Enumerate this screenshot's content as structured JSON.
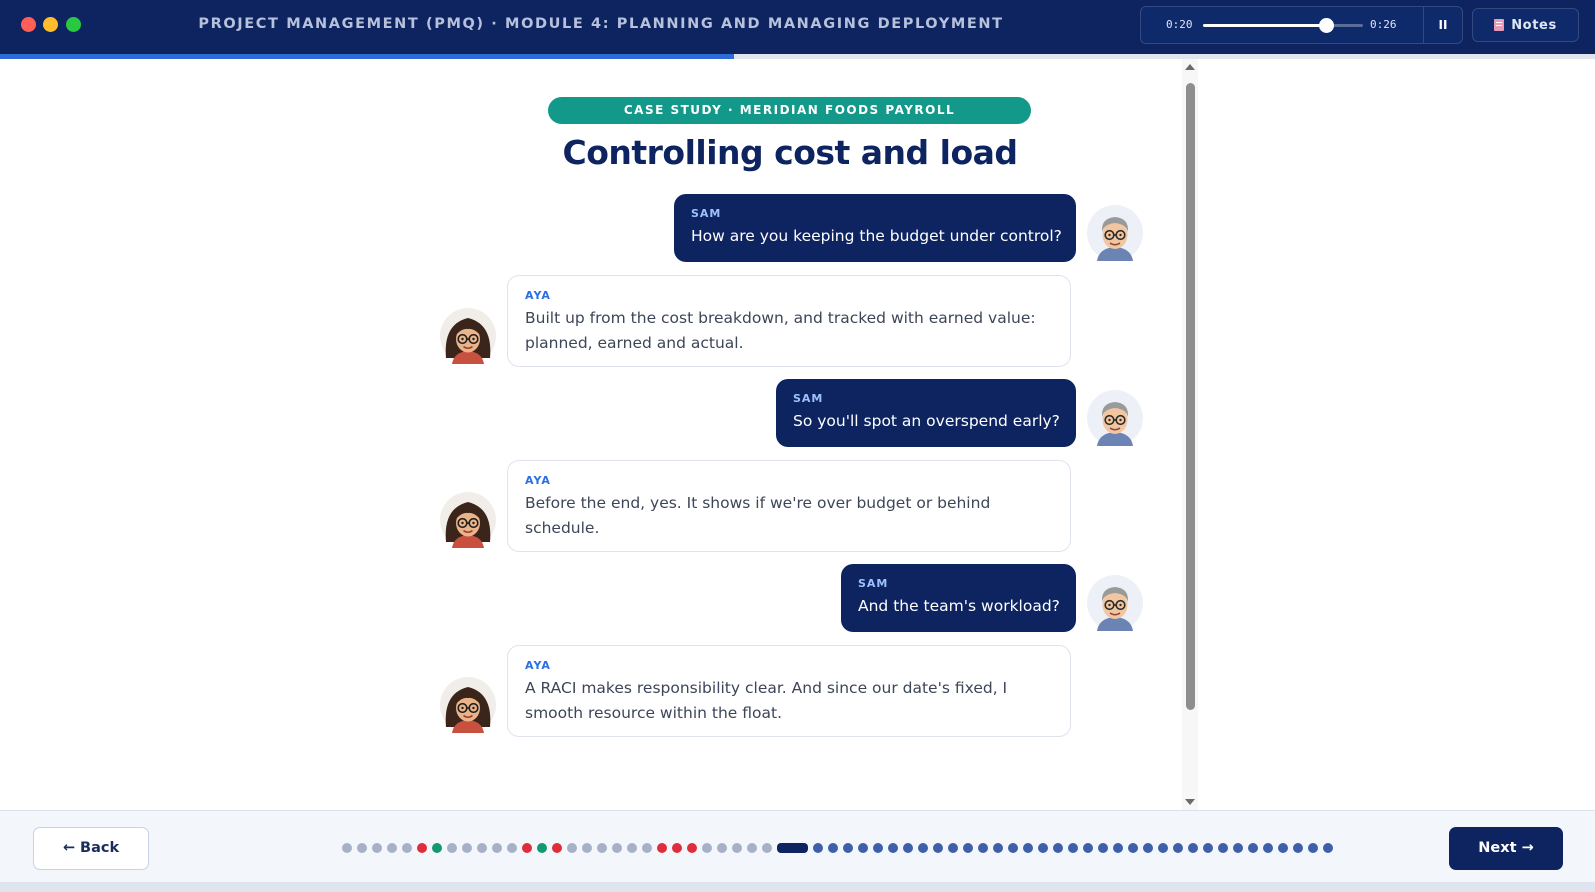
{
  "window": {
    "title": "PROJECT MANAGEMENT (PMQ) · MODULE 4: PLANNING AND MANAGING DEPLOYMENT"
  },
  "player": {
    "current_time": "0:20",
    "total_time": "0:26",
    "progress": 0.769,
    "pause_label": "II",
    "notes_label": "Notes"
  },
  "course_progress": 0.46,
  "slide": {
    "badge": "CASE STUDY · MERIDIAN FOODS PAYROLL",
    "title": "Controlling cost and load",
    "messages": [
      {
        "speaker": "SAM",
        "text": "How are you keeping the budget under control?"
      },
      {
        "speaker": "AYA",
        "text": "Built up from the cost breakdown, and tracked with earned value: planned, earned and actual."
      },
      {
        "speaker": "SAM",
        "text": "So you'll spot an overspend early?"
      },
      {
        "speaker": "AYA",
        "text": "Before the end, yes. It shows if we're over budget or behind schedule."
      },
      {
        "speaker": "SAM",
        "text": "And the team's workload?"
      },
      {
        "speaker": "AYA",
        "text": "A RACI makes responsibility clear. And since our date's fixed, I smooth resource within the float."
      }
    ]
  },
  "nav": {
    "back_label": "← Back",
    "next_label": "Next →",
    "slide_states": [
      "done",
      "done",
      "done",
      "done",
      "done",
      "wrong",
      "correct",
      "done",
      "done",
      "done",
      "done",
      "done",
      "wrong",
      "correct",
      "wrong",
      "done",
      "done",
      "done",
      "done",
      "done",
      "done",
      "wrong",
      "wrong",
      "wrong",
      "done",
      "done",
      "done",
      "done",
      "done",
      "current",
      "todo",
      "todo",
      "todo",
      "todo",
      "todo",
      "todo",
      "todo",
      "todo",
      "todo",
      "todo",
      "todo",
      "todo",
      "todo",
      "todo",
      "todo",
      "todo",
      "todo",
      "todo",
      "todo",
      "todo",
      "todo",
      "todo",
      "todo",
      "todo",
      "todo",
      "todo",
      "todo",
      "todo",
      "todo",
      "todo",
      "todo",
      "todo",
      "todo",
      "todo",
      "todo"
    ]
  },
  "colors": {
    "navy": "#0d2461",
    "accent": "#2f6bd8",
    "teal": "#13998a",
    "wrong": "#e02d3c",
    "correct": "#129970"
  },
  "icons": {
    "pause": "pause-icon",
    "notes": "notepad-icon",
    "sam_avatar": "man-avatar-icon",
    "aya_avatar": "woman-avatar-icon"
  }
}
